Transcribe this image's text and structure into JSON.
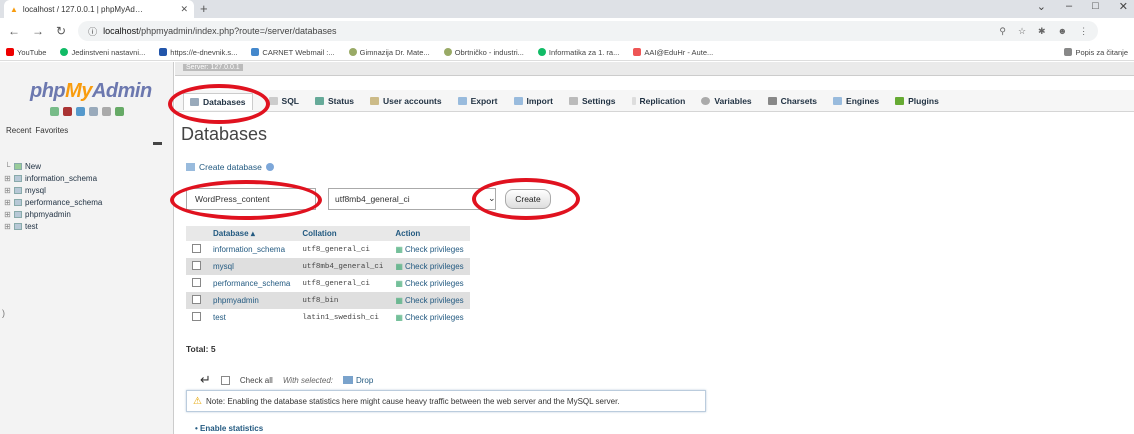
{
  "browser": {
    "tab_title": "localhost / 127.0.0.1 | phpMyAd…",
    "url_host": "localhost",
    "url_path": "/phpmyadmin/index.php?route=/server/databases",
    "bookmarks": [
      "YouTube",
      "Jedinstveni nastavni...",
      "https://e-dnevnik.s...",
      "CARNET Webmail :...",
      "Gimnazija Dr. Mate...",
      "Obrtničko - industri...",
      "Informatika za 1. ra...",
      "AAI@EduHr - Aute..."
    ],
    "reading_list": "Popis za čitanje"
  },
  "sidebar": {
    "logo_php": "php",
    "logo_my": "My",
    "logo_admin": "Admin",
    "recent": "Recent",
    "favorites": "Favorites",
    "databases": [
      "New",
      "information_schema",
      "mysql",
      "performance_schema",
      "phpmyadmin",
      "test"
    ]
  },
  "header": {
    "server_crumb": "Server: 127.0.0.1"
  },
  "menu": {
    "items": [
      "Databases",
      "SQL",
      "Status",
      "User accounts",
      "Export",
      "Import",
      "Settings",
      "Replication",
      "Variables",
      "Charsets",
      "Engines",
      "Plugins"
    ],
    "active": "Databases"
  },
  "main": {
    "title": "Databases",
    "create_db_label": "Create database",
    "db_name_value": "WordPress_content",
    "collation_value": "utf8mb4_general_ci",
    "create_button": "Create",
    "table": {
      "headers": [
        "Database",
        "Collation",
        "Action"
      ],
      "sort_indicator": "▴",
      "rows": [
        {
          "name": "information_schema",
          "collation": "utf8_general_ci",
          "action": "Check privileges"
        },
        {
          "name": "mysql",
          "collation": "utf8mb4_general_ci",
          "action": "Check privileges"
        },
        {
          "name": "performance_schema",
          "collation": "utf8_general_ci",
          "action": "Check privileges"
        },
        {
          "name": "phpmyadmin",
          "collation": "utf8_bin",
          "action": "Check privileges"
        },
        {
          "name": "test",
          "collation": "latin1_swedish_ci",
          "action": "Check privileges"
        }
      ]
    },
    "total": "Total: 5",
    "check_all": "Check all",
    "with_selected": "With selected:",
    "drop": "Drop",
    "note": "Note: Enabling the database statistics here might cause heavy traffic between the web server and the MySQL server.",
    "enable_statistics": "Enable statistics"
  },
  "colors": {
    "accent": "#235a81",
    "annotation": "#e0121f",
    "logo_blue": "#6c78af",
    "logo_orange": "#f89c0e"
  }
}
